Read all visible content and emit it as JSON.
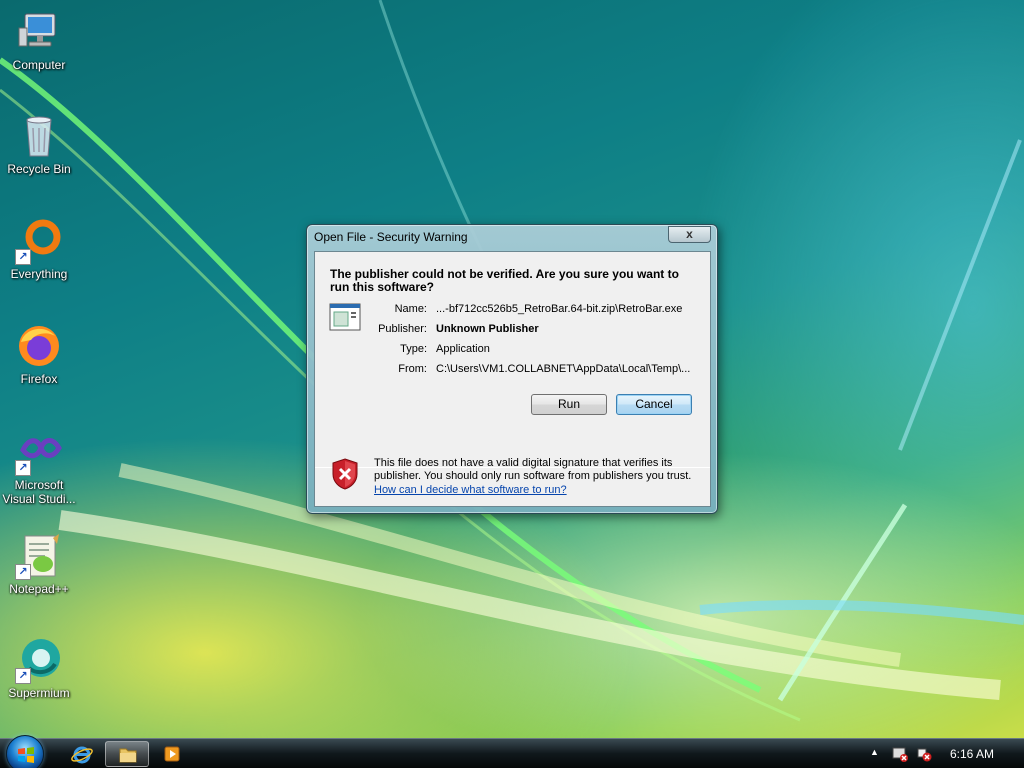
{
  "desktop": {
    "icons": [
      {
        "label": "Computer"
      },
      {
        "label": "Recycle Bin"
      },
      {
        "label": "Everything"
      },
      {
        "label": "Firefox"
      },
      {
        "label": "Microsoft Visual Studi..."
      },
      {
        "label": "Notepad++"
      },
      {
        "label": "Supermium"
      }
    ]
  },
  "dialog": {
    "title": "Open File - Security Warning",
    "close_label": "x",
    "question": "The publisher could not be verified.  Are you sure you want to run this software?",
    "properties": [
      {
        "label": "Name:",
        "value": "...-bf712cc526b5_RetroBar.64-bit.zip\\RetroBar.exe"
      },
      {
        "label": "Publisher:",
        "value": "Unknown Publisher"
      },
      {
        "label": "Type:",
        "value": "Application"
      },
      {
        "label": "From:",
        "value": "C:\\Users\\VM1.COLLABNET\\AppData\\Local\\Temp\\..."
      }
    ],
    "run_label": "Run",
    "cancel_label": "Cancel",
    "warning_text": "This file does not have a valid digital signature that verifies its publisher.  You should only run software from publishers you trust.",
    "help_link": "How can I decide what software to run?"
  },
  "taskbar": {
    "clock": "6:16 AM",
    "tray_expand": "▲"
  }
}
